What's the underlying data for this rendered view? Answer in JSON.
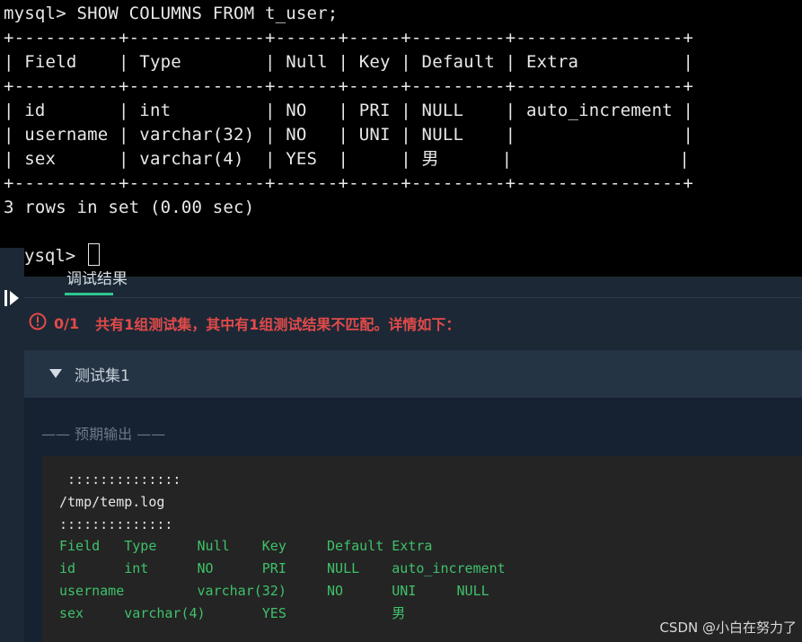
{
  "terminal": {
    "lines": [
      "mysql> SHOW COLUMNS FROM t_user;",
      "+----------+-------------+------+-----+---------+----------------+",
      "| Field    | Type        | Null | Key | Default | Extra          |",
      "+----------+-------------+------+-----+---------+----------------+",
      "| id       | int         | NO   | PRI | NULL    | auto_increment |",
      "| username | varchar(32) | NO   | UNI | NULL    |                |",
      "| sex      | varchar(4)  | YES  |     | 男      |                |",
      "+----------+-------------+------+-----+---------+----------------+",
      "3 rows in set (0.00 sec)",
      ""
    ],
    "prompt": "ysql> "
  },
  "tabs": {
    "active_label": "调试结果"
  },
  "summary": {
    "count": "0/1",
    "message": "共有1组测试集，其中有1组测试结果不匹配。详情如下：",
    "color": "#e24a4a"
  },
  "test_set": {
    "title": "测试集1",
    "expected_label": "—— 预期输出 ——",
    "output_white_lines": [
      " ::::::::::::::",
      "/tmp/temp.log",
      "::::::::::::::"
    ],
    "output_green_lines": [
      "Field   Type     Null    Key     Default Extra",
      "id      int      NO      PRI     NULL    auto_increment",
      "username         varchar(32)     NO      UNI     NULL",
      "sex     varchar(4)       YES             男"
    ]
  },
  "watermark": "CSDN @小白在努力了",
  "colors": {
    "terminal_bg": "#000000",
    "panel_bg": "#1c2836",
    "accent_green": "#2fc58e",
    "error_red": "#e24a4a",
    "output_green": "#3fc16a"
  }
}
